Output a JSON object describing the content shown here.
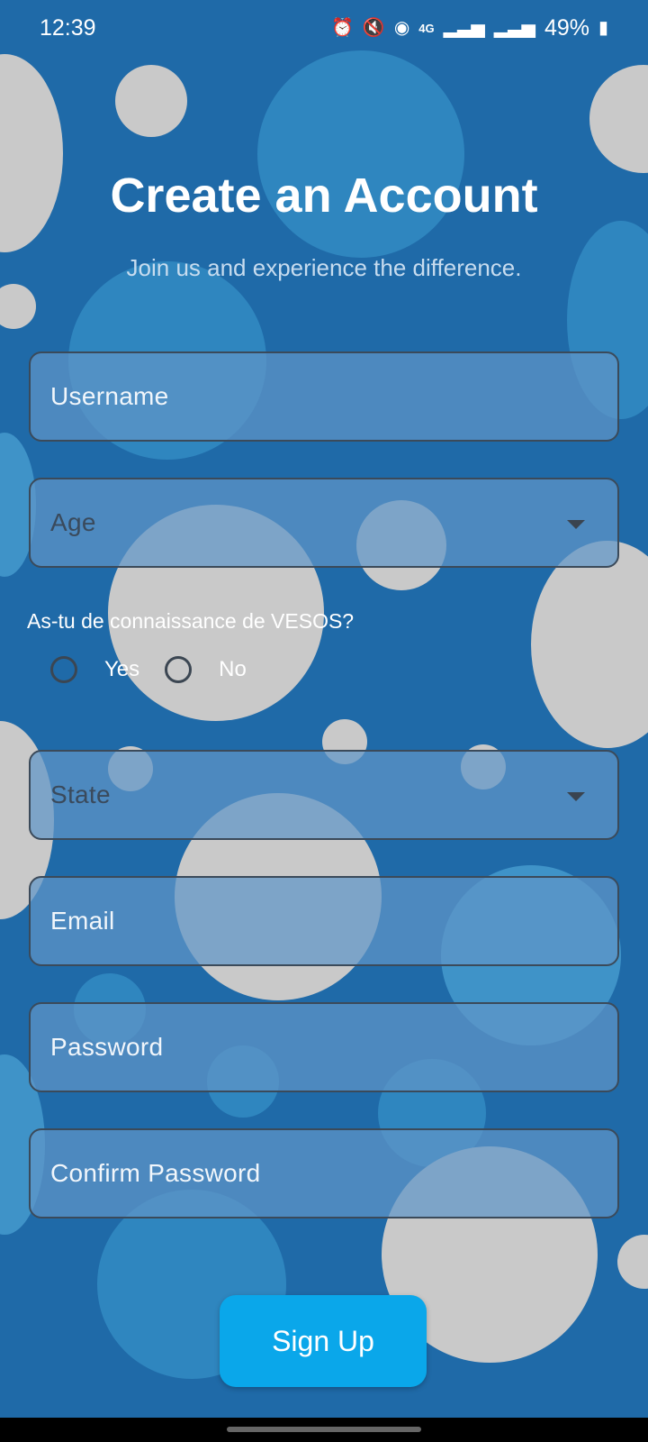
{
  "status_bar": {
    "time": "12:39",
    "battery": "49%",
    "icons": [
      "alarm-icon",
      "mute-icon",
      "hotspot-icon",
      "4g-icon",
      "signal-icon",
      "signal-icon",
      "battery-icon"
    ]
  },
  "header": {
    "title": "Create an Account",
    "subtitle": "Join us and experience the difference."
  },
  "form": {
    "username_label": "Username",
    "age_label": "Age",
    "question": "As-tu de connaissance de VESOS?",
    "radio_options": [
      "Yes",
      "No"
    ],
    "state_label": "State",
    "email_label": "Email",
    "password_label": "Password",
    "confirm_password_label": "Confirm Password",
    "submit_label": "Sign Up"
  },
  "colors": {
    "background": "#1f6aa8",
    "accent": "#0aa7ea",
    "field_fill": "#5f96c8"
  }
}
